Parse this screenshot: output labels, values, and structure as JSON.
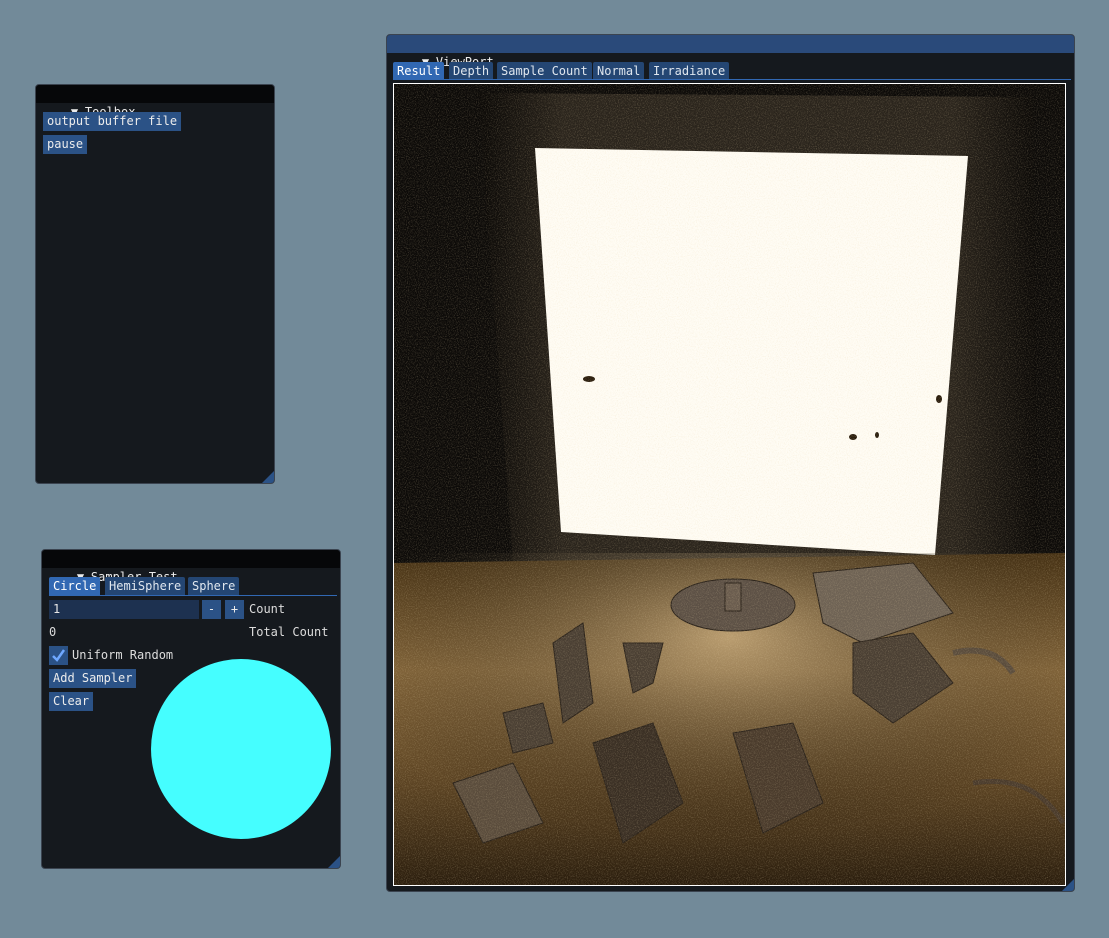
{
  "toolbox": {
    "title": "Toolbox",
    "buttons": [
      "output buffer file",
      "pause"
    ]
  },
  "sampler_test": {
    "title": "Sampler Test",
    "tabs": [
      "Circle",
      "HemiSphere",
      "Sphere"
    ],
    "selected_tab": "Circle",
    "count_value": "1",
    "minus_label": "-",
    "plus_label": "+",
    "count_label": "Count",
    "total_count_value": "0",
    "total_count_label": "Total Count",
    "uniform_random_label": "Uniform Random",
    "uniform_random_checked": true,
    "add_sampler_label": "Add Sampler",
    "clear_label": "Clear",
    "circle_color": "#45feff"
  },
  "viewport": {
    "title": "ViewPort",
    "tabs": [
      "Result",
      "Depth",
      "Sample Count",
      "Normal",
      "Irradiance"
    ],
    "selected_tab": "Result"
  },
  "icons": {
    "collapse": "triangle-down-icon",
    "check": "checkmark-icon",
    "resize": "resize-grip-icon"
  },
  "colors": {
    "background": "#728a99",
    "window_bg": "#15191e",
    "title_active": "#2a4a7a",
    "button": "#2b5286",
    "tab_selected": "#3168b3"
  }
}
